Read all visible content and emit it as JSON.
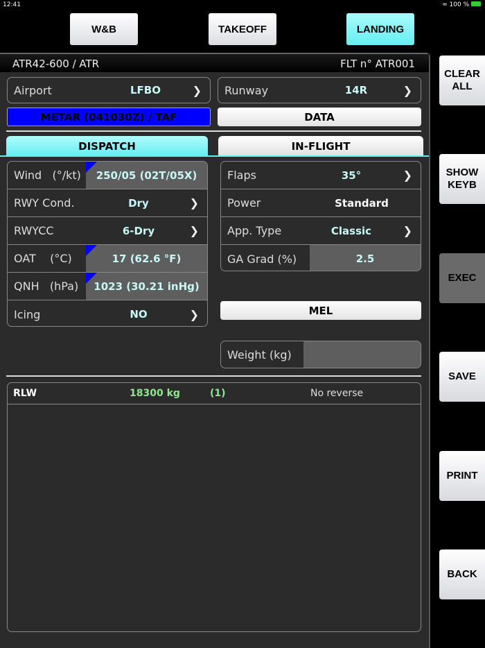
{
  "status": {
    "time": "12:41",
    "battery": "100 %"
  },
  "nav": {
    "wb": "W&B",
    "takeoff": "TAKEOFF",
    "landing": "LANDING"
  },
  "header": {
    "aircraft": "ATR42-600 / ATR",
    "flight": "FLT n° ATR001"
  },
  "airport": {
    "label": "Airport",
    "value": "LFBO"
  },
  "runway": {
    "label": "Runway",
    "value": "14R"
  },
  "metar": "METAR (041030Z) / TAF",
  "data_btn": "DATA",
  "tabs": {
    "dispatch": "DISPATCH",
    "inflight": "IN-FLIGHT"
  },
  "left": [
    {
      "label": "Wind   (°/kt)",
      "value": "250/05 (02T/05X)"
    },
    {
      "label": "RWY Cond.",
      "value": "Dry"
    },
    {
      "label": "RWYCC",
      "value": "6-Dry"
    },
    {
      "label": "OAT    (°C)",
      "value": "17 (62.6 °F)"
    },
    {
      "label": "QNH   (hPa)",
      "value": "1023 (30.21 inHg)"
    },
    {
      "label": "Icing",
      "value": "NO"
    }
  ],
  "right": [
    {
      "label": "Flaps",
      "value": "35°"
    },
    {
      "label": "Power",
      "value": "Standard"
    },
    {
      "label": "App. Type",
      "value": "Classic"
    },
    {
      "label": "GA Grad (%)",
      "value": "2.5"
    }
  ],
  "mel": "MEL",
  "weight": {
    "label": "Weight (kg)",
    "value": ""
  },
  "result": {
    "label": "RLW",
    "weight": "18300 kg",
    "note": "(1)",
    "reverse": "No reverse"
  },
  "sidebar": {
    "clear": "CLEAR ALL",
    "keyb": "SHOW KEYB",
    "exec": "EXEC",
    "save": "SAVE",
    "print": "PRINT",
    "back": "BACK"
  },
  "colors": {
    "accent": "#66eef2",
    "metar": "#0000ff",
    "result_value": "#8fe88f"
  }
}
